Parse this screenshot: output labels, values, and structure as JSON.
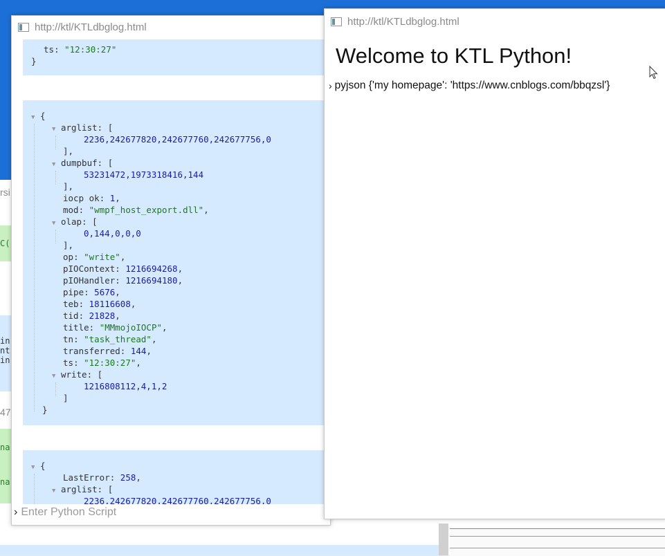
{
  "window_back": {
    "title": "http://ktl/KTLdbglog.html",
    "block1": {
      "ts_key": "ts",
      "ts_value": "\"12:30:27\""
    },
    "block2": {
      "arglist_key": "arglist",
      "arglist_values": "2236,242677820,242677760,242677756,0",
      "dumpbuf_key": "dumpbuf",
      "dumpbuf_values": "53231472,1973318416,144",
      "iocp_ok_key": "iocp ok",
      "iocp_ok_value": "1",
      "mod_key": "mod",
      "mod_value": "\"wmpf_host_export.dll\"",
      "olap_key": "olap",
      "olap_values": "0,144,0,0,0",
      "op_key": "op",
      "op_value": "\"write\"",
      "pIOContext_key": "pIOContext",
      "pIOContext_value": "1216694268",
      "pIOHandler_key": "pIOHandler",
      "pIOHandler_value": "1216694180",
      "pipe_key": "pipe",
      "pipe_value": "5676",
      "teb_key": "teb",
      "teb_value": "18116608",
      "tid_key": "tid",
      "tid_value": "21828",
      "title_key": "title",
      "title_value": "\"MMmojoIOCP\"",
      "tn_key": "tn",
      "tn_value": "\"task_thread\"",
      "transferred_key": "transferred",
      "transferred_value": "144",
      "ts_key": "ts",
      "ts_value": "\"12:30:27\"",
      "write_key": "write",
      "write_values": "1216808112,4,1,2"
    },
    "block3": {
      "lasterror_key": "LastError",
      "lasterror_value": "258",
      "arglist_key": "arglist",
      "arglist_values": "2236,242677820,242677760,242677756,0"
    },
    "input_placeholder": "Enter Python Script"
  },
  "window_front": {
    "title": "http://ktl/KTLdbglog.html",
    "heading": "Welcome to KTL Python!",
    "output_line": "pyjson {'my homepage': 'https://www.cnblogs.com/bbqzsl'}"
  },
  "left_strip_fragments": [
    "rsi",
    "C(",
    "in",
    "nt",
    "in",
    "47",
    "na",
    "na"
  ],
  "colors": {
    "desktop_blue": "#1c6fd6",
    "json_block_bg": "#d6eaff",
    "string_color": "#1a7a1a",
    "number_color": "#1a1aa6"
  }
}
